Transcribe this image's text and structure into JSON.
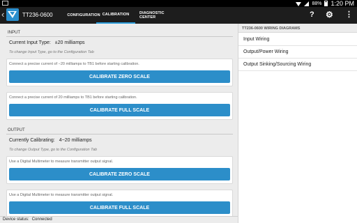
{
  "statusbar": {
    "battery": "88%",
    "time": "1:20 PM"
  },
  "actionbar": {
    "title": "TT236-0600",
    "tabs": [
      {
        "label": "CONFIGURATION"
      },
      {
        "label": "CALIBRATION"
      },
      {
        "label": "DIAGNOSTIC CENTER"
      }
    ],
    "active_tab": "CALIBRATION",
    "accent": "#2a9ad8"
  },
  "input_section": {
    "title": "INPUT",
    "current_label": "Current Input Type:",
    "current_value": "±20 milliamps",
    "hint": "To change Input Type, go to the Configuration Tab",
    "cards": [
      {
        "text": "Connect a precise current of −20 milliamps to TB1 before starting calibration.",
        "button": "CALIBRATE ZERO SCALE"
      },
      {
        "text": "Connect a precise current of 20 milliamps to TB1 before starting calibration.",
        "button": "CALIBRATE FULL SCALE"
      }
    ]
  },
  "output_section": {
    "title": "OUTPUT",
    "current_label": "Currently Calibrating:",
    "current_value": "4−20 milliamps",
    "hint": "To change Output Type, go to the Configuration Tab",
    "cards": [
      {
        "text": "Use a Digital Multimeter to measure transmitter output signal.",
        "button": "CALIBRATE ZERO SCALE"
      },
      {
        "text": "Use a Digital Multimeter to measure transmitter output signal.",
        "button": "CALIBRATE FULL SCALE"
      }
    ]
  },
  "wiring": {
    "title": "TT236-0600 WIRING DIAGRAMS",
    "items": [
      {
        "label": "Input Wiring"
      },
      {
        "label": "Output/Power Wiring"
      },
      {
        "label": "Output Sinking/Sourcing Wiring"
      }
    ]
  },
  "device_status": {
    "label": "Device status:",
    "value": "Connected"
  },
  "colors": {
    "button": "#2c8ec9",
    "actionbar": "#1d1d1d",
    "background": "#ececec"
  }
}
